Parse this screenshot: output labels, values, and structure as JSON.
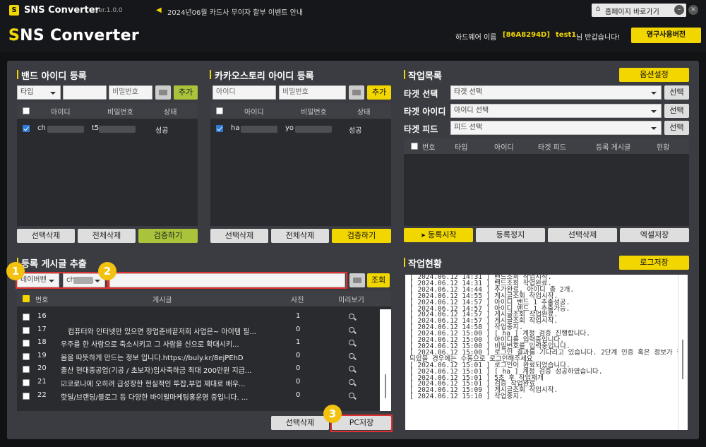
{
  "app": {
    "logo_letter": "S",
    "name": "SNS Converter",
    "version": "Ver.1.0.0",
    "notice": "2024년06월 카드사 무이자 할부 이벤트 안내",
    "home_btn": "홈페이지 바로가기",
    "header_logo": "SNS Converter",
    "hw_label": "하드웨어 이름",
    "hw_id": "[86A8294D]",
    "user": "test1",
    "greet": "님 반갑습니다!",
    "perm_btn": "영구사용버전"
  },
  "band": {
    "title": "밴드 아이디 등록",
    "type_select": "타입",
    "pw_placeholder": "비밀번호",
    "add": "추가",
    "cols": [
      "아이디",
      "비밀번호",
      "상태"
    ],
    "row": {
      "id": "ch",
      "pw": "t5",
      "status": "성공"
    },
    "btn_del_sel": "선택삭제",
    "btn_del_all": "전체삭제",
    "btn_verify": "검증하기"
  },
  "kakao": {
    "title": "카카오스토리 아이디 등록",
    "id_placeholder": "아이디",
    "pw_placeholder": "비밀번호",
    "add": "추가",
    "cols": [
      "아이디",
      "비밀번호",
      "상태"
    ],
    "row": {
      "id": "ha",
      "pw": "yo",
      "status": "성공"
    },
    "btn_del_sel": "선택삭제",
    "btn_del_all": "전체삭제",
    "btn_verify": "검증하기"
  },
  "job": {
    "title": "작업목록",
    "options_btn": "옵션설정",
    "target_select_label": "타겟 선택",
    "target_select_val": "타겟 선택",
    "target_id_label": "타겟 아이디",
    "target_id_val": "아이디 선택",
    "target_feed_label": "타겟 피드",
    "target_feed_val": "피드 선택",
    "select_btn": "선택",
    "cols": [
      "번호",
      "타입",
      "아이디",
      "타겟 피드",
      "등록 게시글",
      "현황"
    ],
    "btn_start": "등록시작",
    "btn_stop": "등록정지",
    "btn_del_sel": "선택삭제",
    "btn_excel": "엑셀저장"
  },
  "extract": {
    "title": "등록 게시글 추출",
    "account_type": "네이버밴",
    "account_id": "ch",
    "search_btn": "조회",
    "cols": [
      "번호",
      "게시글",
      "사진",
      "미리보기"
    ],
    "rows": [
      {
        "no": "16",
        "text": "",
        "photo": "1"
      },
      {
        "no": "17",
        "text": "컴퓨터와 인터넷만 있으면 창업준비끝저희 사업은~ 아이템 필...",
        "photo": "0"
      },
      {
        "no": "18",
        "text": "우주를 한 사람으로 축소시키고 그 사람을 신으로 확대시키...",
        "photo": "1"
      },
      {
        "no": "19",
        "text": "몸을 따뜻하게 만드는 정보 입니다.https://buly.kr/8ejPEhD",
        "photo": "0"
      },
      {
        "no": "20",
        "text": "출산 현대중공업(기공 / 초보자)입사축하금 최대 200만원 지급...",
        "photo": "0"
      },
      {
        "no": "21",
        "text": "☑코로나에 오히려 급성장한 현실적인 투잡,부업 제대로 배우...",
        "photo": "0"
      },
      {
        "no": "22",
        "text": "핫딜/브랜딩/블로그 등 다양한 바이럴마케팅홍운영 중입니다. ...",
        "photo": "0"
      }
    ],
    "btn_del_sel": "선택삭제",
    "btn_pc_save": "PC저장"
  },
  "status": {
    "title": "작업현황",
    "log_btn": "로그저장",
    "log": [
      "[ 2024.06.12 14:31 ] 밴드조회 작업시작.",
      "[ 2024.06.12 14:31 ] 밴드조회 작업완료.",
      "[ 2024.06.12 14:44 ] 추가완료, 아이디 총 2개.",
      "[ 2024.06.12 14:55 ] 게시글조회 작업시작.",
      "[ 2024.06.12 14:57 ] 아이디           밴드 1 추출성공.",
      "[ 2024.06.12 14:57 ] 아이디           밴드 1 추출가능.",
      "[ 2024.06.12 14:57 ] 게시글조회 작업완료.",
      "[ 2024.06.12 14:57 ] 게시글조회 작업시작.",
      "[ 2024.06.12 14:58 ] 작업중지.",
      "[ 2024.06.12 15:00 ] [ ha              ] 계정 검증 진행합니다.",
      "[ 2024.06.12 15:00 ] 아이디를 입력중입니다.",
      "[ 2024.06.12 15:00 ] 비밀번호를 입력중입니다.",
      "[ 2024.06.12 15:00 ] 로그인 결과를 기다리고 있습니다. 2단계 인증 혹은 정보가 잘못",
      "되었을 경우에는 수동으로 로그인해주세요",
      "[ 2024.06.12 15:01 ] 로그인이 완료되었습니다.",
      "[ 2024.06.12 15:01 ] [ ha              ] 계정 검증 성공하였습니다.",
      "[ 2024.06.12 15:01 ] 5초 후 작업재개",
      "[ 2024.06.12 15:01 ] 검증 작업완료",
      "[ 2024.06.12 15:09 ] 게시글조회 작업시작.",
      "[ 2024.06.12 15:10 ] 작업중지."
    ]
  },
  "badges": [
    "1",
    "2",
    "3"
  ],
  "colors": {
    "accent": "#f2d600",
    "green": "#a9c43a",
    "panel": "#3a3c41",
    "dark": "#16171a",
    "highlight": "#e03030"
  },
  "icons": [
    "speaker-icon",
    "home-icon",
    "minimize-icon",
    "close-icon",
    "folder-icon",
    "send-icon",
    "search-icon",
    "checkbox-icon"
  ]
}
